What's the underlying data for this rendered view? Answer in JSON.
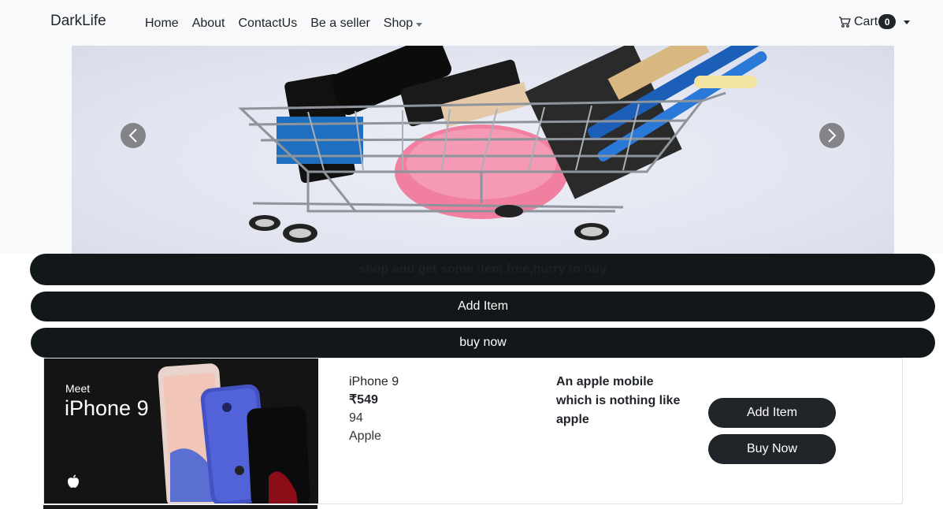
{
  "nav": {
    "brand": "DarkLife",
    "links": [
      "Home",
      "About",
      "ContactUs",
      "Be a seller"
    ],
    "shop_label": "Shop",
    "cart_label": "Cart",
    "cart_count": "0"
  },
  "banner": {
    "promo_text": "shop and get some item free,hurry to buy",
    "add_item_label": "Add Item",
    "buy_now_label": "buy now"
  },
  "product": {
    "image_caption_small": "Meet",
    "image_caption_large": "iPhone 9",
    "name": "iPhone 9",
    "price": "₹549",
    "rating": "94",
    "brand": "Apple",
    "description": "An apple mobile which is nothing like apple",
    "add_label": "Add Item",
    "buy_label": "Buy Now"
  },
  "colors": {
    "dark": "#212529",
    "bar": "#121719",
    "navbar_bg": "#f8f9fa"
  }
}
